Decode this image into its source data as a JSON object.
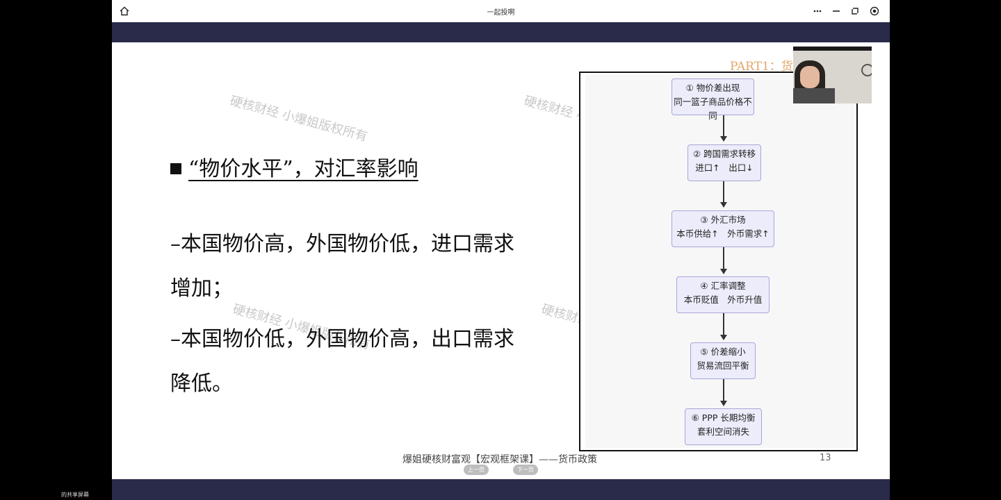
{
  "window": {
    "title": "一起投啊",
    "controls": {
      "home_icon": "home-icon",
      "more_icon": "more-icon",
      "minimize_icon": "minimize-icon",
      "restore_icon": "restore-icon",
      "record_icon": "record-icon"
    }
  },
  "slide": {
    "watermark": "硬核财经 小爆姐版权所有",
    "part_label": "PART1：货",
    "heading": "“物价水平”，对汇率影响",
    "body_lines": [
      "–本国物价高，外国物价低，进口需求",
      "增加；",
      "–本国物价低，外国物价高，出口需求",
      "降低。"
    ],
    "flow": [
      {
        "line1": "① 物价差出现",
        "line2": "同一篮子商品价格不同"
      },
      {
        "line1": "② 跨国需求转移",
        "line2": "进口↑　出口↓"
      },
      {
        "line1": "③ 外汇市场",
        "line2": "本币供给↑　外币需求↑"
      },
      {
        "line1": "④ 汇率调整",
        "line2": "本币贬值　外币升值"
      },
      {
        "line1": "⑤ 价差缩小",
        "line2": "贸易流回平衡"
      },
      {
        "line1": "⑥ PPP 长期均衡",
        "line2": "套利空间消失"
      }
    ],
    "footer": "爆姐硬核财富观【宏观框架课】——货币政策",
    "page_number": "13",
    "prev_label": "上一页",
    "next_label": "下一页"
  },
  "share_label": "的共享屏幕",
  "colors": {
    "band": "#2a2b4b",
    "node_fill": "#ececfb",
    "node_border": "#a9a6d6",
    "part_label": "#e3a56a"
  }
}
